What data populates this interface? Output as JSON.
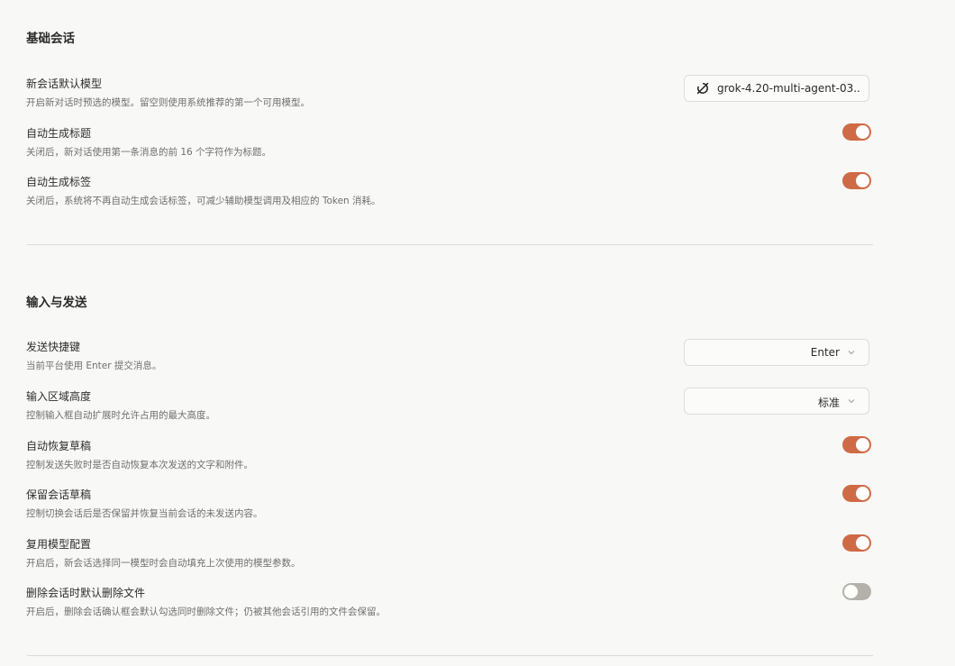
{
  "sections": {
    "basic": {
      "title": "基础会话",
      "default_model": {
        "label": "新会话默认模型",
        "desc": "开启新对话时预选的模型。留空则使用系统推荐的第一个可用模型。",
        "value": "grok-4.20-multi-agent-03...",
        "icon": "grok-logo-icon"
      },
      "auto_title": {
        "label": "自动生成标题",
        "desc": "关闭后，新对话使用第一条消息的前 16 个字符作为标题。",
        "enabled": true
      },
      "auto_tags": {
        "label": "自动生成标签",
        "desc": "关闭后，系统将不再自动生成会话标签，可减少辅助模型调用及相应的 Token 消耗。",
        "enabled": true
      }
    },
    "input": {
      "title": "输入与发送",
      "send_shortcut": {
        "label": "发送快捷键",
        "desc": "当前平台使用 Enter 提交消息。",
        "value": "Enter"
      },
      "input_height": {
        "label": "输入区域高度",
        "desc": "控制输入框自动扩展时允许占用的最大高度。",
        "value": "标准"
      },
      "restore_draft": {
        "label": "自动恢复草稿",
        "desc": "控制发送失败时是否自动恢复本次发送的文字和附件。",
        "enabled": true
      },
      "keep_draft": {
        "label": "保留会话草稿",
        "desc": "控制切换会话后是否保留并恢复当前会话的未发送内容。",
        "enabled": true
      },
      "reuse_config": {
        "label": "复用模型配置",
        "desc": "开启后，新会话选择同一模型时会自动填充上次使用的模型参数。",
        "enabled": true
      },
      "delete_files": {
        "label": "删除会话时默认删除文件",
        "desc": "开启后，删除会话确认框会默认勾选同时删除文件；仍被其他会话引用的文件会保留。",
        "enabled": false
      }
    }
  },
  "colors": {
    "toggle_on": "#cf6a47",
    "toggle_off": "#b3b1aa",
    "background": "#f8f8f6"
  }
}
